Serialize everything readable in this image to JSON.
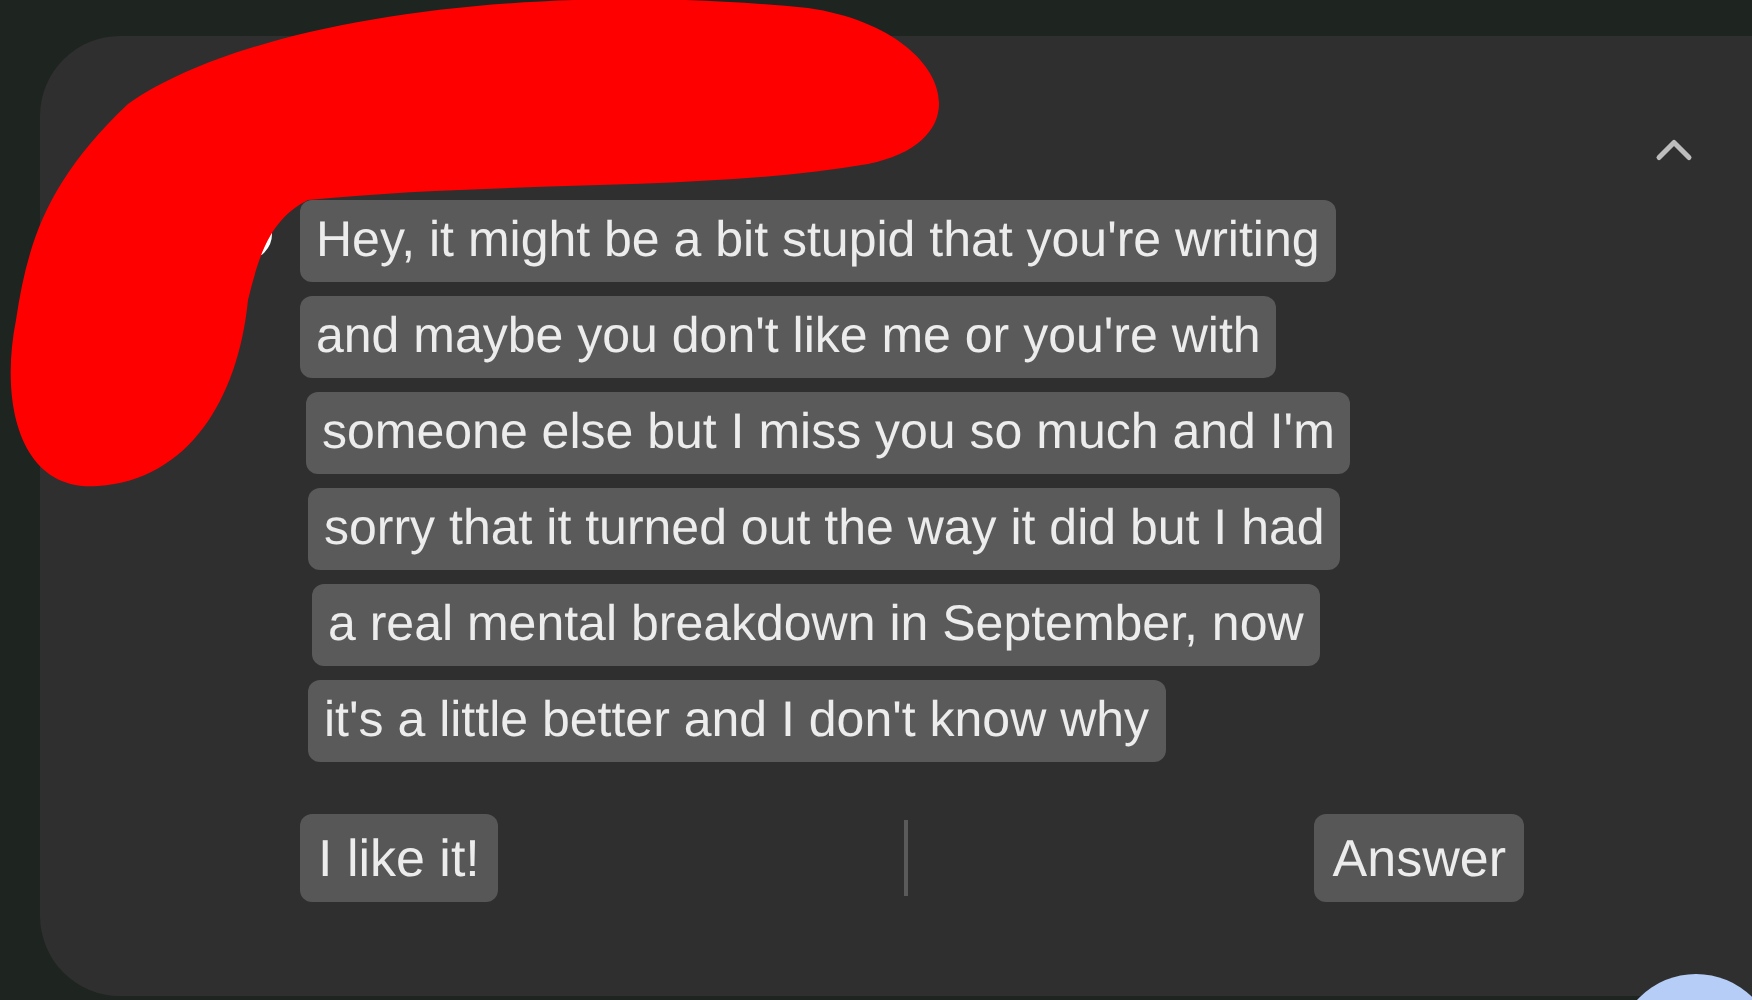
{
  "notification": {
    "expanded": true,
    "message_lines": [
      "Hey, it might be a bit stupid that you're writing",
      "and maybe you don't like me or you're with",
      "someone else but I miss you so much and I'm",
      "sorry that it turned out the way it did but I had",
      "a real mental breakdown in September, now",
      "it's a little better and I don't know why"
    ],
    "actions": [
      "I like it!",
      "Answer"
    ]
  }
}
